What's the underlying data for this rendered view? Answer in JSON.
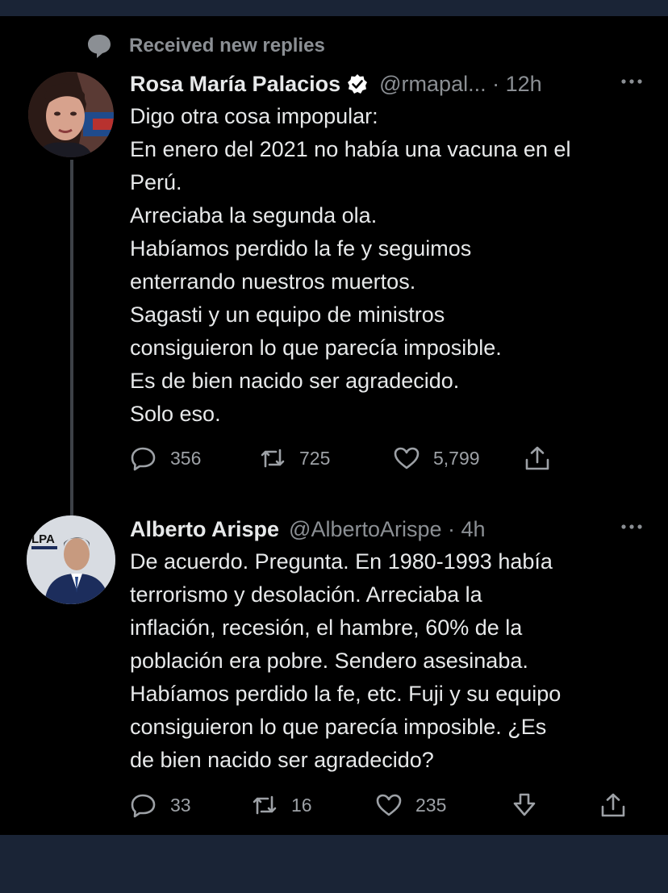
{
  "notice": {
    "text": "Received new replies",
    "icon": "speech-bubble-icon"
  },
  "colors": {
    "background": "#000000",
    "text": "#e7e9ea",
    "muted": "#8b8f94",
    "verified": "#ffffff",
    "frame": "#1a2436"
  },
  "tweets": [
    {
      "name": "Rosa María Palacios",
      "verified": true,
      "handle": "@rmapal... · 12h",
      "lines": [
        "Digo otra cosa impopular:",
        "En enero del 2021 no había una vacuna en el",
        "Perú.",
        "Arreciaba la segunda ola.",
        "Habíamos perdido la fe y seguimos",
        "enterrando nuestros muertos.",
        "Sagasti y un equipo de ministros",
        "consiguieron lo que parecía imposible.",
        "Es de bien nacido ser agradecido.",
        "Solo eso."
      ],
      "replies": "356",
      "retweets": "725",
      "likes": "5,799"
    },
    {
      "name": "Alberto Arispe",
      "verified": false,
      "handle": "@AlbertoArispe · 4h",
      "avatar_logo": "LPA",
      "lines": [
        "De acuerdo. Pregunta. En 1980-1993 había",
        "terrorismo y desolación. Arreciaba la",
        "inflación, recesión, el hambre, 60% de la",
        "población era pobre. Sendero asesinaba.",
        "Habíamos perdido la fe, etc. Fuji y su equipo",
        "consiguieron lo que parecía imposible. ¿Es",
        "de bien nacido ser agradecido?"
      ],
      "replies": "33",
      "retweets": "16",
      "likes": "235"
    }
  ]
}
